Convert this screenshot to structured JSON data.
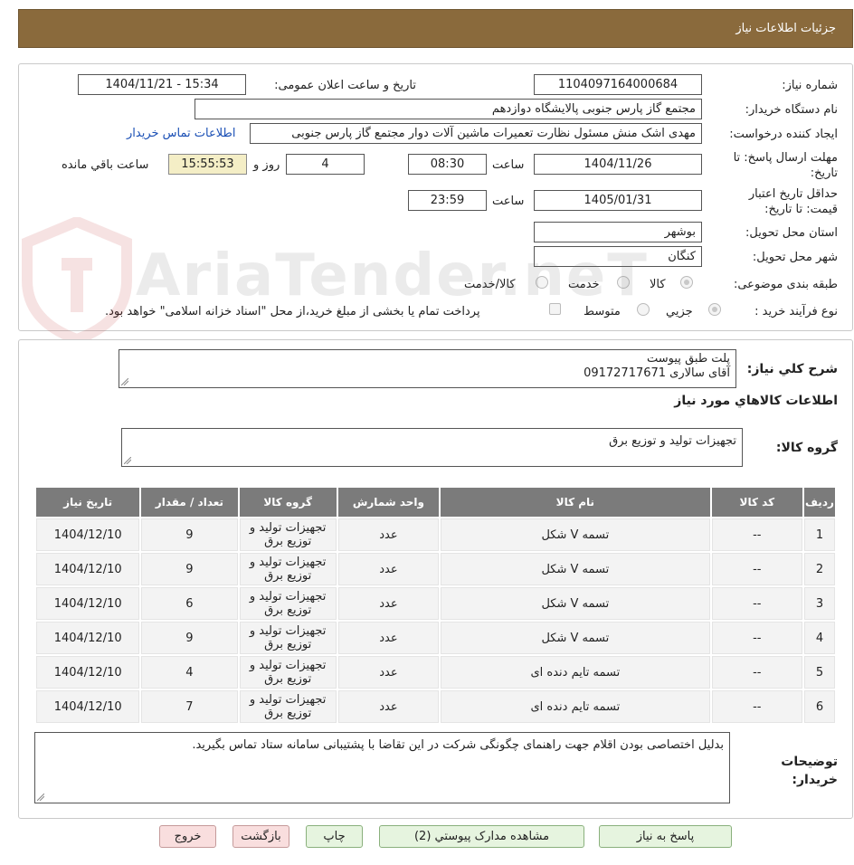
{
  "header": {
    "title": "جزئیات اطلاعات نیاز"
  },
  "form": {
    "need_number_label": "شماره نیاز:",
    "need_number": "1104097164000684",
    "announce_label": "تاریخ و ساعت اعلان عمومی:",
    "announce_value": "1404/11/21 - 15:34",
    "buyer_label": "نام دستگاه خریدار:",
    "buyer_value": "مجتمع گاز پارس جنوبی  پالایشگاه دوازدهم",
    "requester_label": "ایجاد کننده درخواست:",
    "requester_value": "مهدی اشک منش مسئول نظارت تعمیرات ماشین آلات دوار مجتمع گاز پارس جنوبی",
    "contact_link": "اطلاعات تماس خریدار",
    "deadline_label": "مهلت ارسال پاسخ: تا تاریخ:",
    "deadline_date": "1404/11/26",
    "time_label": "ساعت",
    "deadline_time": "08:30",
    "days_value": "4",
    "days_label": "روز و",
    "remaining_value": "15:55:53",
    "remaining_label": "ساعت باقي مانده",
    "validity_label": "حداقل تاریخ اعتبار قیمت: تا تاریخ:",
    "validity_date": "1405/01/31",
    "validity_time": "23:59",
    "province_label": "استان محل تحویل:",
    "province_value": "بوشهر",
    "city_label": "شهر محل تحویل:",
    "city_value": "کنگان",
    "category_label": "طبقه بندی موضوعی:",
    "category_options": [
      "کالا",
      "خدمت",
      "کالا/خدمت"
    ],
    "process_label": "نوع فرآیند خرید :",
    "process_options": [
      "جزیي",
      "متوسط"
    ],
    "payment_note": "پرداخت تمام یا بخشی از مبلغ خرید،از محل \"اسناد خزانه اسلامی\" خواهد بود."
  },
  "summary": {
    "description_label": "شرح کلي نیاز:",
    "description_line1": "پلت طبق پیوست",
    "description_line2": "آقای سالاری 09172717671",
    "goods_info_title": "اطلاعات کالاهاي مورد نیاز",
    "group_label": "گروه کالا:",
    "group_value": "تجهیزات تولید و توزیع برق"
  },
  "table": {
    "headers": [
      "ردیف",
      "کد کالا",
      "نام کالا",
      "واحد شمارش",
      "گروه کالا",
      "تعداد / مقدار",
      "تاریخ نیاز"
    ],
    "rows": [
      {
        "idx": "1",
        "code": "--",
        "name": "تسمه V شکل",
        "unit": "عدد",
        "group1": "تجهیزات تولید و",
        "group2": "توزیع برق",
        "qty": "9",
        "date": "1404/12/10"
      },
      {
        "idx": "2",
        "code": "--",
        "name": "تسمه V شکل",
        "unit": "عدد",
        "group1": "تجهیزات تولید و",
        "group2": "توزیع برق",
        "qty": "9",
        "date": "1404/12/10"
      },
      {
        "idx": "3",
        "code": "--",
        "name": "تسمه V شکل",
        "unit": "عدد",
        "group1": "تجهیزات تولید و",
        "group2": "توزیع برق",
        "qty": "6",
        "date": "1404/12/10"
      },
      {
        "idx": "4",
        "code": "--",
        "name": "تسمه V شکل",
        "unit": "عدد",
        "group1": "تجهیزات تولید و",
        "group2": "توزیع برق",
        "qty": "9",
        "date": "1404/12/10"
      },
      {
        "idx": "5",
        "code": "--",
        "name": "تسمه تایم دنده ای",
        "unit": "عدد",
        "group1": "تجهیزات تولید و",
        "group2": "توزیع برق",
        "qty": "4",
        "date": "1404/12/10"
      },
      {
        "idx": "6",
        "code": "--",
        "name": "تسمه تایم دنده ای",
        "unit": "عدد",
        "group1": "تجهیزات تولید و",
        "group2": "توزیع برق",
        "qty": "7",
        "date": "1404/12/10"
      }
    ]
  },
  "notes": {
    "label_line1": "توضیحات",
    "label_line2": "خریدار:",
    "text": "بدلیل اختصاصی بودن اقلام جهت راهنمای چگونگی شرکت در این تقاضا با پشتیبانی سامانه ستاد تماس بگیرید."
  },
  "buttons": {
    "reply": "پاسخ به نیاز",
    "attachments": "مشاهده مدارک پیوستي (2)",
    "print": "چاپ",
    "back": "بازگشت",
    "exit": "خروج"
  },
  "watermark": {
    "text": "AriaTender.neT"
  },
  "colors": {
    "header_bg": "#8a6a3c",
    "table_header_bg": "#7b7b7b",
    "link": "#1a4fb5",
    "remaining_bg": "#f4eec6"
  }
}
